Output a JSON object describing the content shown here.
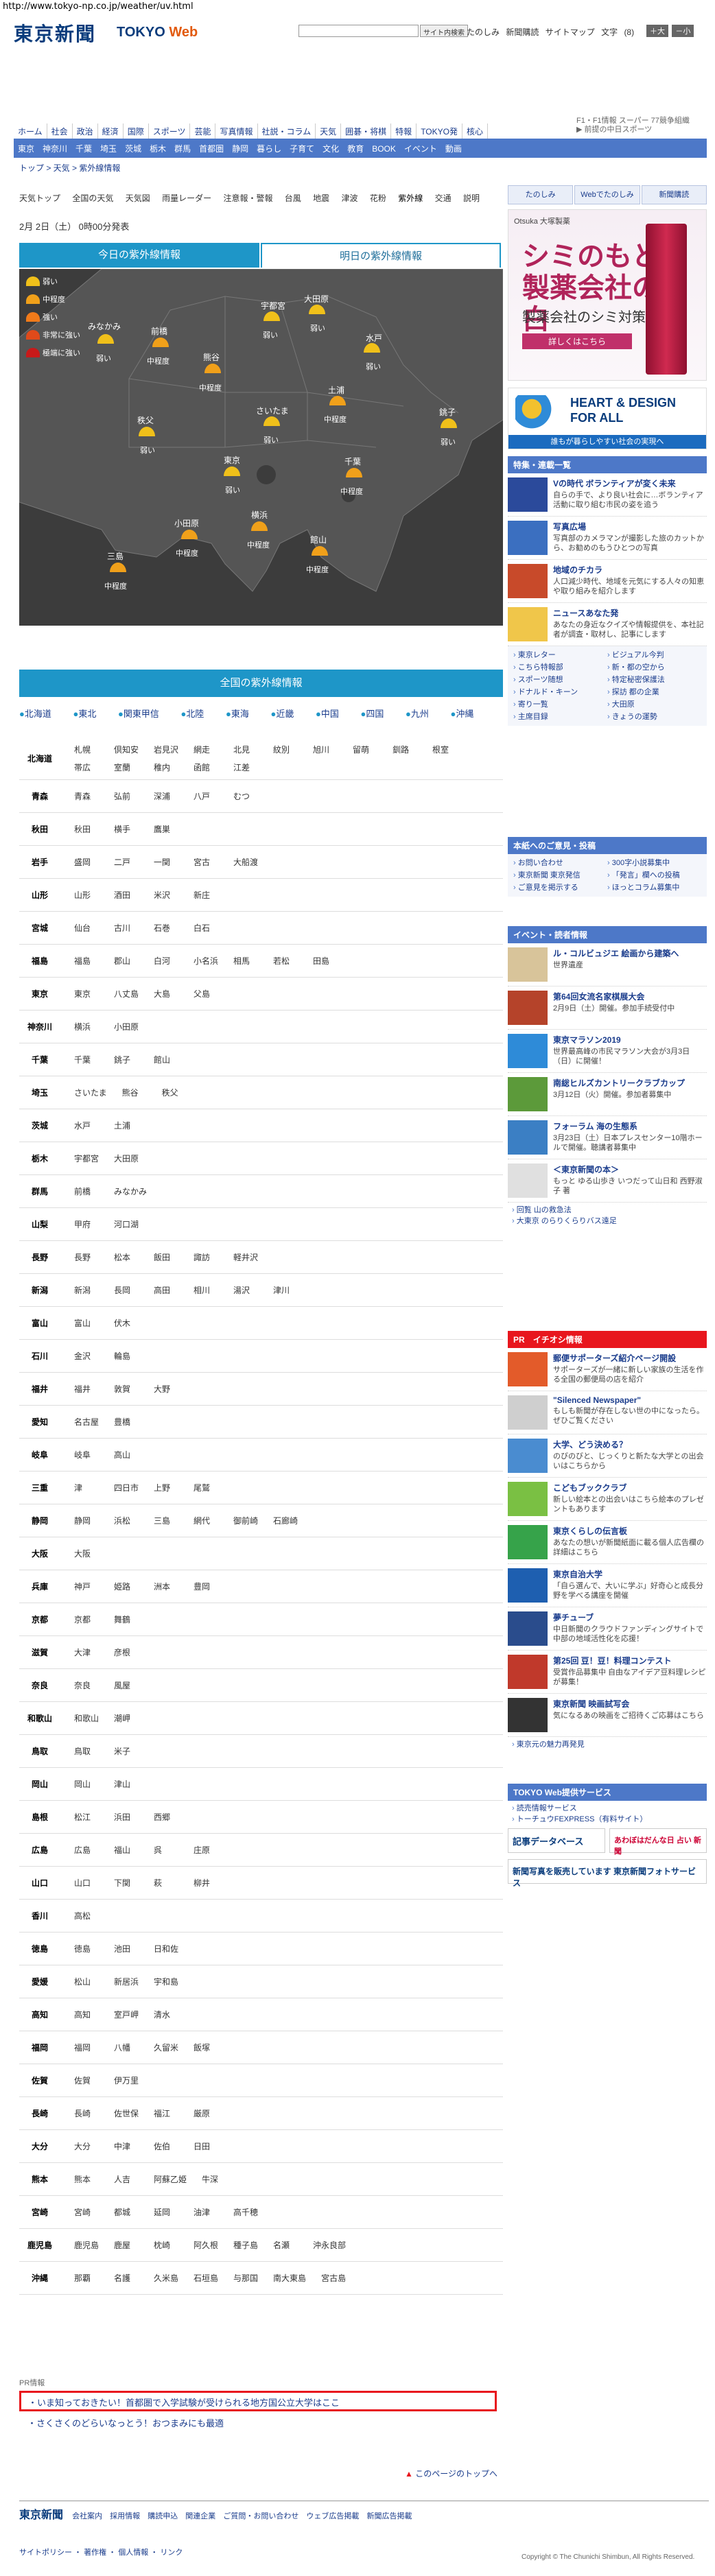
{
  "url": "http://www.tokyo-np.co.jp/weather/uv.html",
  "header": {
    "logo": "東京新聞",
    "logo_sub": "TOKYO",
    "logo_sub2": "Web",
    "search_button": "サイト内検索",
    "links": [
      "たのしみ",
      "新聞購読",
      "サイトマップ",
      "文字",
      "(8)"
    ],
    "font_buttons": [
      "＋大",
      "－小"
    ]
  },
  "top_right": {
    "line1": "F1・F1情報 スーパー 77競争組織",
    "line2": "▶ 前提の中日スポーツ",
    "brand": "中日スポーツ"
  },
  "nav1": [
    "ホーム",
    "社会",
    "政治",
    "経済",
    "国際",
    "スポーツ",
    "芸能",
    "写真情報",
    "社説・コラム",
    "天気",
    "囲碁・将棋",
    "特報",
    "TOKYO発",
    "核心"
  ],
  "nav2": [
    "東京",
    "神奈川",
    "千葉",
    "埼玉",
    "茨城",
    "栃木",
    "群馬",
    "首都圏",
    "静岡",
    "暮らし",
    "子育て",
    "文化",
    "教育",
    "BOOK",
    "イベント",
    "動画"
  ],
  "breadcrumb": "トップ > 天気 > 紫外線情報",
  "subnav": [
    "天気トップ",
    "全国の天気",
    "天気図",
    "雨量レーダー",
    "注意報・警報",
    "台風",
    "地震",
    "津波",
    "花粉",
    "紫外線",
    "交通",
    "説明"
  ],
  "date": "2月 2日（土） 0時00分発表",
  "tabs": {
    "today": "今日の紫外線情報",
    "tomorrow": "明日の紫外線情報"
  },
  "map": {
    "legend": [
      "弱い",
      "中程度",
      "強い",
      "非常に強い",
      "極端に強い"
    ],
    "cities": [
      {
        "name": "みなかみ",
        "level": "弱い"
      },
      {
        "name": "前橋",
        "level": "中程度"
      },
      {
        "name": "宇都宮",
        "level": "弱い"
      },
      {
        "name": "大田原",
        "level": "弱い"
      },
      {
        "name": "熊谷",
        "level": "中程度"
      },
      {
        "name": "水戸",
        "level": "弱い"
      },
      {
        "name": "土浦",
        "level": "中程度"
      },
      {
        "name": "秩父",
        "level": "弱い"
      },
      {
        "name": "さいたま",
        "level": "弱い"
      },
      {
        "name": "銚子",
        "level": "弱い"
      },
      {
        "name": "東京",
        "level": "弱い"
      },
      {
        "name": "千葉",
        "level": "中程度"
      },
      {
        "name": "小田原",
        "level": "中程度"
      },
      {
        "name": "横浜",
        "level": "中程度"
      },
      {
        "name": "三島",
        "level": "中程度"
      },
      {
        "name": "館山",
        "level": "中程度"
      }
    ]
  },
  "national_header": "全国の紫外線情報",
  "regions": [
    "北海道",
    "東北",
    "関東甲信",
    "北陸",
    "東海",
    "近畿",
    "中国",
    "四国",
    "九州",
    "沖縄"
  ],
  "prefectures": [
    {
      "name": "北海道",
      "cities": [
        "札幌",
        "倶知安",
        "岩見沢",
        "網走",
        "北見",
        "紋別",
        "旭川",
        "留萌",
        "釧路",
        "根室",
        "帯広",
        "室蘭",
        "稚内",
        "函館",
        "江差"
      ]
    },
    {
      "name": "青森",
      "cities": [
        "青森",
        "弘前",
        "深浦",
        "八戸",
        "むつ"
      ]
    },
    {
      "name": "秋田",
      "cities": [
        "秋田",
        "横手",
        "鷹巣"
      ]
    },
    {
      "name": "岩手",
      "cities": [
        "盛岡",
        "二戸",
        "一関",
        "宮古",
        "大船渡"
      ]
    },
    {
      "name": "山形",
      "cities": [
        "山形",
        "酒田",
        "米沢",
        "新庄"
      ]
    },
    {
      "name": "宮城",
      "cities": [
        "仙台",
        "古川",
        "石巻",
        "白石"
      ]
    },
    {
      "name": "福島",
      "cities": [
        "福島",
        "郡山",
        "白河",
        "小名浜",
        "相馬",
        "若松",
        "田島"
      ]
    },
    {
      "name": "東京",
      "cities": [
        "東京",
        "八丈島",
        "大島",
        "父島"
      ]
    },
    {
      "name": "神奈川",
      "cities": [
        "横浜",
        "小田原"
      ]
    },
    {
      "name": "千葉",
      "cities": [
        "千葉",
        "銚子",
        "館山"
      ]
    },
    {
      "name": "埼玉",
      "cities": [
        "さいたま",
        "熊谷",
        "秩父"
      ]
    },
    {
      "name": "茨城",
      "cities": [
        "水戸",
        "土浦"
      ]
    },
    {
      "name": "栃木",
      "cities": [
        "宇都宮",
        "大田原"
      ]
    },
    {
      "name": "群馬",
      "cities": [
        "前橋",
        "みなかみ"
      ]
    },
    {
      "name": "山梨",
      "cities": [
        "甲府",
        "河口湖"
      ]
    },
    {
      "name": "長野",
      "cities": [
        "長野",
        "松本",
        "飯田",
        "諏訪",
        "軽井沢"
      ]
    },
    {
      "name": "新潟",
      "cities": [
        "新潟",
        "長岡",
        "高田",
        "相川",
        "湯沢",
        "津川"
      ]
    },
    {
      "name": "富山",
      "cities": [
        "富山",
        "伏木"
      ]
    },
    {
      "name": "石川",
      "cities": [
        "金沢",
        "輪島"
      ]
    },
    {
      "name": "福井",
      "cities": [
        "福井",
        "敦賀",
        "大野"
      ]
    },
    {
      "name": "愛知",
      "cities": [
        "名古屋",
        "豊橋"
      ]
    },
    {
      "name": "岐阜",
      "cities": [
        "岐阜",
        "高山"
      ]
    },
    {
      "name": "三重",
      "cities": [
        "津",
        "四日市",
        "上野",
        "尾鷲"
      ]
    },
    {
      "name": "静岡",
      "cities": [
        "静岡",
        "浜松",
        "三島",
        "網代",
        "御前崎",
        "石廊崎"
      ]
    },
    {
      "name": "大阪",
      "cities": [
        "大阪"
      ]
    },
    {
      "name": "兵庫",
      "cities": [
        "神戸",
        "姫路",
        "洲本",
        "豊岡"
      ]
    },
    {
      "name": "京都",
      "cities": [
        "京都",
        "舞鶴"
      ]
    },
    {
      "name": "滋賀",
      "cities": [
        "大津",
        "彦根"
      ]
    },
    {
      "name": "奈良",
      "cities": [
        "奈良",
        "風屋"
      ]
    },
    {
      "name": "和歌山",
      "cities": [
        "和歌山",
        "潮岬"
      ]
    },
    {
      "name": "鳥取",
      "cities": [
        "鳥取",
        "米子"
      ]
    },
    {
      "name": "岡山",
      "cities": [
        "岡山",
        "津山"
      ]
    },
    {
      "name": "島根",
      "cities": [
        "松江",
        "浜田",
        "西郷"
      ]
    },
    {
      "name": "広島",
      "cities": [
        "広島",
        "福山",
        "呉",
        "庄原"
      ]
    },
    {
      "name": "山口",
      "cities": [
        "山口",
        "下関",
        "萩",
        "柳井"
      ]
    },
    {
      "name": "香川",
      "cities": [
        "高松"
      ]
    },
    {
      "name": "徳島",
      "cities": [
        "徳島",
        "池田",
        "日和佐"
      ]
    },
    {
      "name": "愛媛",
      "cities": [
        "松山",
        "新居浜",
        "宇和島"
      ]
    },
    {
      "name": "高知",
      "cities": [
        "高知",
        "室戸岬",
        "清水"
      ]
    },
    {
      "name": "福岡",
      "cities": [
        "福岡",
        "八幡",
        "久留米",
        "飯塚"
      ]
    },
    {
      "name": "佐賀",
      "cities": [
        "佐賀",
        "伊万里"
      ]
    },
    {
      "name": "長崎",
      "cities": [
        "長崎",
        "佐世保",
        "福江",
        "厳原"
      ]
    },
    {
      "name": "大分",
      "cities": [
        "大分",
        "中津",
        "佐伯",
        "日田"
      ]
    },
    {
      "name": "熊本",
      "cities": [
        "熊本",
        "人吉",
        "阿蘇乙姫",
        "牛深"
      ]
    },
    {
      "name": "宮崎",
      "cities": [
        "宮崎",
        "都城",
        "延岡",
        "油津",
        "高千穂"
      ]
    },
    {
      "name": "鹿児島",
      "cities": [
        "鹿児島",
        "鹿屋",
        "枕崎",
        "阿久根",
        "種子島",
        "名瀬",
        "沖永良部"
      ]
    },
    {
      "name": "沖縄",
      "cities": [
        "那覇",
        "名護",
        "久米島",
        "石垣島",
        "与那国",
        "南大東島",
        "宮古島"
      ]
    }
  ],
  "pr": {
    "label": "PR情報",
    "link1": "いま知っておきたい！首都圏で入学試験が受けられる地方国公立大学はここ",
    "link2": "さくさくのどらいなっとう！おつまみにも最適"
  },
  "page_top": "このページのトップへ",
  "footer": {
    "logo": "東京新聞",
    "links": [
      "会社案内",
      "採用情報",
      "購読申込",
      "関連企業",
      "ご質問・お問い合わせ",
      "ウェブ広告掲載",
      "新聞広告掲載"
    ],
    "links2": [
      "サイトポリシー",
      "著作権",
      "個人情報",
      "リンク"
    ],
    "copyright": "Copyright © The Chunichi Shimbun, All Rights Reserved."
  },
  "right": {
    "tabs": [
      "たのしみ",
      "Webでたのしみ",
      "新聞購読"
    ],
    "ad1": {
      "brand": "Otsuka 大塚製薬",
      "big1": "シミのもとに",
      "big2": "製薬会社の美白",
      "small": "製薬会社のシミ対策",
      "btn": "詳しくはこちら"
    },
    "ad2": {
      "line1": "HEART & DESIGN",
      "line2": "FOR ALL",
      "bar": "誰もが暮らしやすい社会の実現へ"
    },
    "feature": {
      "title": "特集・連載一覧",
      "items": [
        {
          "title": "Vの時代 ボランティアが変く未来",
          "desc": "自らの手で、より良い社会に…ボランティア活動に取り組む市民の姿を追う"
        },
        {
          "title": "写真広場",
          "desc": "写真部のカメラマンが撮影した旅のカットから、お勧めのもうひとつの写真"
        },
        {
          "title": "地域のチカラ",
          "desc": "人口減少時代、地域を元気にする人々の知恵や取り組みを紹介します"
        },
        {
          "title": "ニュースあなた発",
          "desc": "あなたの身近なクイズや情報提供を、本社記者が調査・取材し、記事にします"
        }
      ],
      "links": [
        "東京レター",
        "ビジュアル今判",
        "こちら特報部",
        "新・都の空から",
        "スポーツ随想",
        "特定秘密保護法",
        "ドナルド・キーン",
        "探訪 都の企業",
        "寄り一覧",
        "大田原",
        "主席目録",
        "きょうの運勢"
      ]
    },
    "readers": {
      "title": "本紙へのご意見・投稿",
      "links": [
        "お問い合わせ",
        "300字小説募集中",
        "東京新聞 東京発信",
        "「発言」欄への投稿",
        "ご意見を掲示する",
        "ほっとコラム募集中"
      ]
    },
    "events": {
      "title": "イベント・読者情報",
      "items": [
        {
          "title": "ル・コルビュジエ 絵画から建築へ",
          "desc": "世界遺産"
        },
        {
          "title": "第64回女流名家棋展大会",
          "desc": "2月9日（土）開催。参加手続受付中"
        },
        {
          "title": "東京マラソン2019",
          "desc": "世界最高峰の市民マラソン大会が3月3日（日）に開催！"
        },
        {
          "title": "南総ヒルズカントリークラブカップ",
          "desc": "3月12日（火）開催。参加者募集中"
        },
        {
          "title": "フォーラム 海の生態系",
          "desc": "3月23日（土）日本プレスセンター10階ホールで開催。聴講者募集中"
        },
        {
          "title": "＜東京新聞の本＞",
          "desc": "もっと ゆる山歩き いつだって山日和 西野淑子 著"
        }
      ],
      "small": [
        "回覧 山の救急法",
        "大東京 のらりくらりバス遠足"
      ]
    },
    "iine": {
      "title": "イチオシ情報",
      "pr": "PR",
      "items": [
        {
          "title": "郵便サポーターズ紹介ページ開設",
          "desc": "サポーターズが一緒に新しい家族の生活を作る全国の郵便局の店を紹介"
        },
        {
          "title": "\"Silenced Newspaper\"",
          "desc": "もしも新聞が存在しない世の中になったら。ぜひご覧ください"
        },
        {
          "title": "大学、どう決める？",
          "desc": "のびのびと、じっくりと新たな大学との出会いはこちらから"
        },
        {
          "title": "こどもブッククラブ",
          "desc": "新しい絵本との出会いはこちら絵本のプレゼントもあります"
        },
        {
          "title": "東京くらしの伝言板",
          "desc": "あなたの想いが新聞紙面に載る個人広告欄の詳細はこちら"
        },
        {
          "title": "東京自治大学",
          "desc": "「自ら選んで、大いに学ぶ」好奇心と成長分野を学べる講座を開催"
        },
        {
          "title": "夢チューブ",
          "desc": "中日新聞のクラウドファンディングサイトで中部の地域活性化を応援！"
        },
        {
          "title": "第25回 豆！豆！料理コンテスト",
          "desc": "受賞作品募集中 自由なアイデア豆料理レシピが募集！"
        },
        {
          "title": "東京新聞 映画試写会",
          "desc": "気になるあの映画をご招待くご応募はこちら"
        }
      ],
      "small": [
        "東京元の魅力再発見"
      ]
    },
    "service": {
      "title": "TOKYO Web提供サービス",
      "links": [
        "読売情報サービス",
        "トーチュウFEXPRESS（有料サイト）"
      ]
    },
    "bottom_ads": [
      "記事データベース",
      "あわぼはだんな日 占い 新聞",
      "新聞写真を販売しています 東京新聞フォトサービス"
    ]
  },
  "colors": {
    "primary": "#1e96c8",
    "nav": "#4d78c8",
    "brand": "#0a3c7c",
    "alert": "#e8161d"
  }
}
